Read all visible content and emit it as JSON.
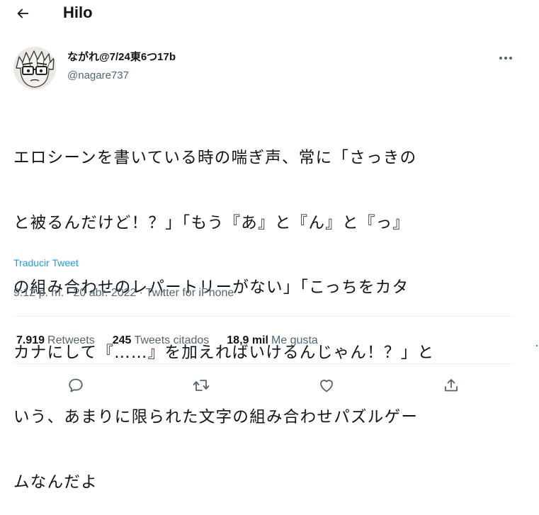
{
  "header": {
    "back_icon": "arrow-left-icon",
    "title": "Hilo"
  },
  "tweet": {
    "author": {
      "display_name": "ながれ@7/24東6つ17b",
      "handle": "@nagare737",
      "avatar": "manga-glasses-face-avatar"
    },
    "more_icon": "more-horizontal-icon",
    "text_lines": [
      "エロシーンを書いている時の喘ぎ声、常に「さっきの",
      "と被るんだけど！？」「もう『あ』と『ん』と『っ』",
      "の組み合わせのレパートリーがない」「こっちをカタ",
      "カナにして『……』を加えればいけるんじゃん！？」と",
      "いう、あまりに限られた文字の組み合わせパズルゲー",
      "ムなんだよ"
    ],
    "translate_label": "Traducir Tweet",
    "time": "9:12 p. m.",
    "date": "20 abr. 2022",
    "separator": "·",
    "source": "Twitter for iPhone",
    "stats": {
      "retweets_count": "7.919",
      "retweets_label": "Retweets",
      "quotes_count": "245",
      "quotes_label": "Tweets citados",
      "likes_count": "18,9 mil",
      "likes_label": "Me gusta"
    },
    "actions": [
      {
        "name": "reply",
        "icon": "reply-icon"
      },
      {
        "name": "retweet",
        "icon": "retweet-icon"
      },
      {
        "name": "like",
        "icon": "heart-icon"
      },
      {
        "name": "share",
        "icon": "share-icon"
      }
    ]
  },
  "colors": {
    "text_primary": "#0f1419",
    "text_secondary": "#536471",
    "link": "#1d9bf0",
    "divider": "#eff3f4"
  }
}
